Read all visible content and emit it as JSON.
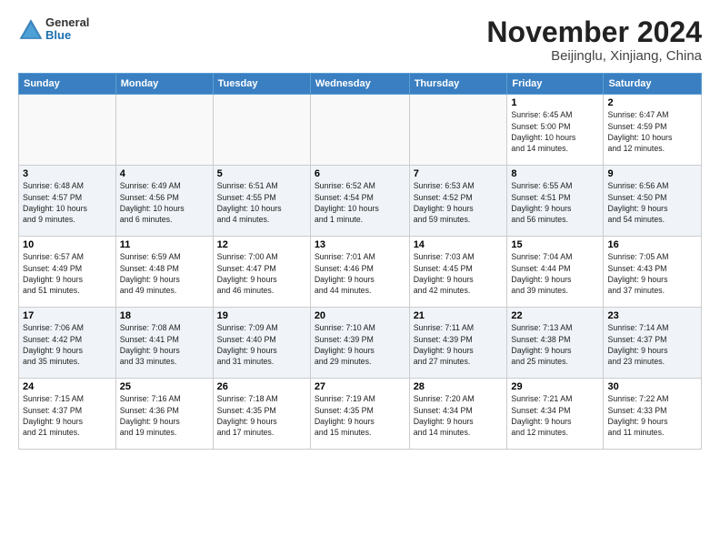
{
  "header": {
    "logo_general": "General",
    "logo_blue": "Blue",
    "month_title": "November 2024",
    "subtitle": "Beijinglu, Xinjiang, China"
  },
  "days_of_week": [
    "Sunday",
    "Monday",
    "Tuesday",
    "Wednesday",
    "Thursday",
    "Friday",
    "Saturday"
  ],
  "weeks": [
    [
      {
        "num": "",
        "info": ""
      },
      {
        "num": "",
        "info": ""
      },
      {
        "num": "",
        "info": ""
      },
      {
        "num": "",
        "info": ""
      },
      {
        "num": "",
        "info": ""
      },
      {
        "num": "1",
        "info": "Sunrise: 6:45 AM\nSunset: 5:00 PM\nDaylight: 10 hours\nand 14 minutes."
      },
      {
        "num": "2",
        "info": "Sunrise: 6:47 AM\nSunset: 4:59 PM\nDaylight: 10 hours\nand 12 minutes."
      }
    ],
    [
      {
        "num": "3",
        "info": "Sunrise: 6:48 AM\nSunset: 4:57 PM\nDaylight: 10 hours\nand 9 minutes."
      },
      {
        "num": "4",
        "info": "Sunrise: 6:49 AM\nSunset: 4:56 PM\nDaylight: 10 hours\nand 6 minutes."
      },
      {
        "num": "5",
        "info": "Sunrise: 6:51 AM\nSunset: 4:55 PM\nDaylight: 10 hours\nand 4 minutes."
      },
      {
        "num": "6",
        "info": "Sunrise: 6:52 AM\nSunset: 4:54 PM\nDaylight: 10 hours\nand 1 minute."
      },
      {
        "num": "7",
        "info": "Sunrise: 6:53 AM\nSunset: 4:52 PM\nDaylight: 9 hours\nand 59 minutes."
      },
      {
        "num": "8",
        "info": "Sunrise: 6:55 AM\nSunset: 4:51 PM\nDaylight: 9 hours\nand 56 minutes."
      },
      {
        "num": "9",
        "info": "Sunrise: 6:56 AM\nSunset: 4:50 PM\nDaylight: 9 hours\nand 54 minutes."
      }
    ],
    [
      {
        "num": "10",
        "info": "Sunrise: 6:57 AM\nSunset: 4:49 PM\nDaylight: 9 hours\nand 51 minutes."
      },
      {
        "num": "11",
        "info": "Sunrise: 6:59 AM\nSunset: 4:48 PM\nDaylight: 9 hours\nand 49 minutes."
      },
      {
        "num": "12",
        "info": "Sunrise: 7:00 AM\nSunset: 4:47 PM\nDaylight: 9 hours\nand 46 minutes."
      },
      {
        "num": "13",
        "info": "Sunrise: 7:01 AM\nSunset: 4:46 PM\nDaylight: 9 hours\nand 44 minutes."
      },
      {
        "num": "14",
        "info": "Sunrise: 7:03 AM\nSunset: 4:45 PM\nDaylight: 9 hours\nand 42 minutes."
      },
      {
        "num": "15",
        "info": "Sunrise: 7:04 AM\nSunset: 4:44 PM\nDaylight: 9 hours\nand 39 minutes."
      },
      {
        "num": "16",
        "info": "Sunrise: 7:05 AM\nSunset: 4:43 PM\nDaylight: 9 hours\nand 37 minutes."
      }
    ],
    [
      {
        "num": "17",
        "info": "Sunrise: 7:06 AM\nSunset: 4:42 PM\nDaylight: 9 hours\nand 35 minutes."
      },
      {
        "num": "18",
        "info": "Sunrise: 7:08 AM\nSunset: 4:41 PM\nDaylight: 9 hours\nand 33 minutes."
      },
      {
        "num": "19",
        "info": "Sunrise: 7:09 AM\nSunset: 4:40 PM\nDaylight: 9 hours\nand 31 minutes."
      },
      {
        "num": "20",
        "info": "Sunrise: 7:10 AM\nSunset: 4:39 PM\nDaylight: 9 hours\nand 29 minutes."
      },
      {
        "num": "21",
        "info": "Sunrise: 7:11 AM\nSunset: 4:39 PM\nDaylight: 9 hours\nand 27 minutes."
      },
      {
        "num": "22",
        "info": "Sunrise: 7:13 AM\nSunset: 4:38 PM\nDaylight: 9 hours\nand 25 minutes."
      },
      {
        "num": "23",
        "info": "Sunrise: 7:14 AM\nSunset: 4:37 PM\nDaylight: 9 hours\nand 23 minutes."
      }
    ],
    [
      {
        "num": "24",
        "info": "Sunrise: 7:15 AM\nSunset: 4:37 PM\nDaylight: 9 hours\nand 21 minutes."
      },
      {
        "num": "25",
        "info": "Sunrise: 7:16 AM\nSunset: 4:36 PM\nDaylight: 9 hours\nand 19 minutes."
      },
      {
        "num": "26",
        "info": "Sunrise: 7:18 AM\nSunset: 4:35 PM\nDaylight: 9 hours\nand 17 minutes."
      },
      {
        "num": "27",
        "info": "Sunrise: 7:19 AM\nSunset: 4:35 PM\nDaylight: 9 hours\nand 15 minutes."
      },
      {
        "num": "28",
        "info": "Sunrise: 7:20 AM\nSunset: 4:34 PM\nDaylight: 9 hours\nand 14 minutes."
      },
      {
        "num": "29",
        "info": "Sunrise: 7:21 AM\nSunset: 4:34 PM\nDaylight: 9 hours\nand 12 minutes."
      },
      {
        "num": "30",
        "info": "Sunrise: 7:22 AM\nSunset: 4:33 PM\nDaylight: 9 hours\nand 11 minutes."
      }
    ]
  ]
}
